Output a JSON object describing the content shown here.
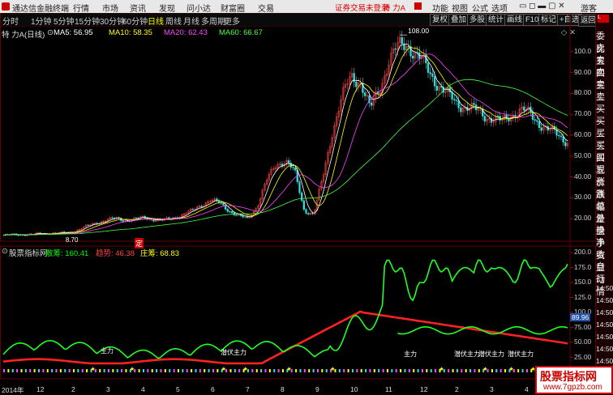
{
  "titlebar": {
    "app_name": "通达信金融终端",
    "menus": [
      "行情",
      "市场",
      "资讯",
      "发现",
      "问小达",
      "财富圈",
      "交易"
    ],
    "warning": "证券交易未登录",
    "symbol": "特 力A",
    "right_menus": [
      "功能",
      "视图",
      "公式",
      "选项"
    ],
    "guest": "游客"
  },
  "tabs": [
    "分时",
    "1分钟",
    "5分钟",
    "15分钟",
    "30分钟",
    "60分钟",
    "日线",
    "周线",
    "月线",
    "多周期",
    "更多"
  ],
  "active_tab": "日线",
  "toolbar": [
    "复权",
    "叠加",
    "多股",
    "统计",
    "画线",
    "F10",
    "标记",
    "+自选",
    "返回"
  ],
  "main_header": {
    "stock": "特 力A",
    "period": "(日线)",
    "ma5": "MA5: 56.95",
    "ma10": "MA10: 58.35",
    "ma20": "MA20: 62.43",
    "ma60": "MA60: 66.67"
  },
  "colors": {
    "ma5": "#ffffff",
    "ma10": "#ffff00",
    "ma20": "#ff44ff",
    "ma60": "#44ff44",
    "up": "#ff4444",
    "down": "#33dddd"
  },
  "price_axis": [
    "100.0",
    "90.00",
    "80.00",
    "70.00",
    "60.00",
    "50.00",
    "40.00",
    "30.00",
    "20.00"
  ],
  "price_high_label": "108.00",
  "price_low_label": "8.70",
  "ding_label": "定",
  "indicator_header": {
    "name": "股票指标网",
    "s1": "散筹: 160.41",
    "s2": "趋势: 46.38",
    "s3": "庄筹: 68.83"
  },
  "indicator_axis": [
    "200.0",
    "175.0",
    "150.0",
    "125.0",
    "100.0",
    "75.00",
    "50.00",
    "25.00"
  ],
  "indicator_marker": "89.96",
  "indicator_annotations": [
    "主力",
    "潜伏主力",
    "主力",
    "潜伏主力",
    "潜伏主力",
    "潜伏主力"
  ],
  "x_labels": [
    "2014年",
    "12",
    "2",
    "3",
    "4",
    "5",
    "6",
    "7",
    "8",
    "9",
    "10",
    "11",
    "12",
    "2",
    "3",
    "4"
  ],
  "right_panel": [
    "委比",
    "卖五",
    "卖四",
    "卖三",
    "卖二",
    "卖一",
    "买一",
    "买二",
    "买三",
    "买四",
    "买五",
    "现价",
    "涨跌",
    "涨幅",
    "总量",
    "外盘",
    "换手",
    "净资",
    "收益",
    "自动",
    "行情",
    "14:50",
    "14:50",
    "14:50",
    "14:50",
    "14:50",
    "14:50",
    "14:50",
    "14:50",
    "14:50"
  ],
  "watermark": {
    "line1": "股票指标网",
    "line2": "www.7gpzb.com"
  },
  "chart_data": {
    "type": "candlestick",
    "title": "特 力A (日线)",
    "x_ticks": [
      "2014年",
      "12",
      "2",
      "3",
      "4",
      "5",
      "6",
      "7",
      "8",
      "9",
      "10",
      "11",
      "12",
      "2",
      "3",
      "4"
    ],
    "ylim": [
      10,
      110
    ],
    "close": [
      12,
      12.3,
      12.5,
      12.4,
      12.8,
      13.1,
      13,
      13.4,
      14.8,
      16.5,
      18.2,
      19.5,
      20,
      19.2,
      19.8,
      20.5,
      19.7,
      19.2,
      20.3,
      21.8,
      23.5,
      26.5,
      28.8,
      27.5,
      24,
      21.2,
      20,
      26,
      38,
      46,
      48,
      42,
      24,
      22,
      40,
      62,
      78,
      88,
      86,
      72,
      82,
      96,
      102,
      104,
      98,
      92,
      86,
      80,
      76,
      74,
      72,
      70,
      68,
      66,
      70,
      72,
      70,
      66,
      62,
      60,
      57
    ],
    "ma60_end": 66.67,
    "ma20_end": 62.43,
    "ma10_end": 58.35,
    "ma5_end": 56.95
  }
}
